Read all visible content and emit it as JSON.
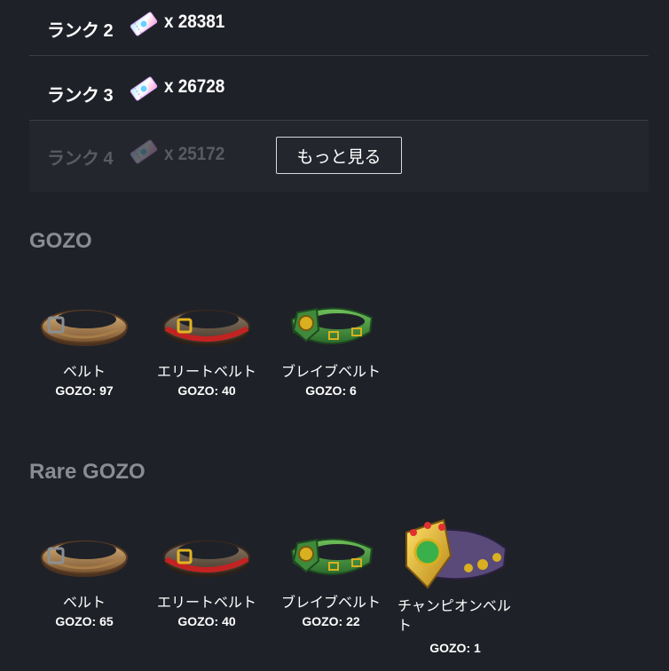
{
  "ranking": {
    "rows": [
      {
        "label": "ランク 2",
        "count": "x 28381"
      },
      {
        "label": "ランク 3",
        "count": "x 26728"
      },
      {
        "label": "ランク 4",
        "count": "x 25172"
      }
    ],
    "more_button": "もっと見る"
  },
  "gozo": {
    "title": "GOZO",
    "items": [
      {
        "name": "ベルト",
        "count": "GOZO: 97",
        "icon": "belt-brown-icon"
      },
      {
        "name": "エリートベルト",
        "count": "GOZO: 40",
        "icon": "belt-elite-icon"
      },
      {
        "name": "ブレイブベルト",
        "count": "GOZO: 6",
        "icon": "belt-brave-icon"
      }
    ]
  },
  "rare_gozo": {
    "title": "Rare GOZO",
    "items": [
      {
        "name": "ベルト",
        "count": "GOZO: 65",
        "icon": "belt-brown-icon"
      },
      {
        "name": "エリートベルト",
        "count": "GOZO: 40",
        "icon": "belt-elite-icon"
      },
      {
        "name": "ブレイブベルト",
        "count": "GOZO: 22",
        "icon": "belt-brave-icon"
      },
      {
        "name": "チャンピオンベルト",
        "count": "GOZO: 1",
        "icon": "belt-champion-icon"
      }
    ]
  },
  "colors": {
    "background": "#1f2128",
    "muted_title": "#8a8c91",
    "divider": "#3a3d45"
  }
}
